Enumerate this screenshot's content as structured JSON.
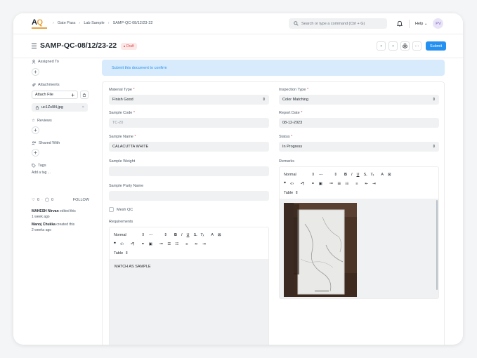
{
  "navbar": {
    "logo_text": "AQ",
    "breadcrumb": [
      "Gate Pass",
      "Lab Sample",
      "SAMP-QC-08/12/23-22"
    ],
    "search_placeholder": "Search or type a command (Ctrl + G)",
    "help_label": "Help",
    "avatar_initials": "PV"
  },
  "page": {
    "title": "SAMP-QC-08/12/23-22",
    "status": "Draft",
    "submit_label": "Submit",
    "more_label": "···"
  },
  "alert": {
    "text": "Submit this document to confirm"
  },
  "sidebar": {
    "assigned_to": "Assigned To",
    "attachments": "Attachments",
    "attach_file": "Attach File",
    "file_name": "uc1Zs9N.jpg",
    "reviews": "Reviews",
    "shared_with": "Shared With",
    "tags": "Tags",
    "add_tag": "Add a tag ...",
    "likes": "0",
    "comments": "0",
    "follow": "FOLLOW",
    "activity": [
      {
        "user": "MAHESH Nirvan",
        "action": "edited this",
        "time": "1 week ago"
      },
      {
        "user": "Manoj Chukka",
        "action": "created this",
        "time": "2 weeks ago"
      }
    ]
  },
  "form": {
    "material_type": {
      "label": "Material Type",
      "value": "Finish Good"
    },
    "sample_code": {
      "label": "Sample Code",
      "value": "TC-20"
    },
    "sample_name": {
      "label": "Sample Name",
      "value": "CALACUTTA WHITE"
    },
    "sample_weight": {
      "label": "Sample Weight",
      "value": ""
    },
    "sample_party_name": {
      "label": "Sample Party Name",
      "value": ""
    },
    "mesh_qc": {
      "label": "Mesh QC",
      "checked": false
    },
    "requirements": {
      "label": "Requirements",
      "value": "MATCH AS SAMPLE"
    },
    "inspection_type": {
      "label": "Inspection Type",
      "value": "Color Matching"
    },
    "report_date": {
      "label": "Report Date",
      "value": "08-12-2023"
    },
    "status": {
      "label": "Status",
      "value": "In Progress"
    },
    "remarks": {
      "label": "Remarks"
    }
  },
  "editor_toolbar": {
    "style": "Normal",
    "size": "---",
    "table": "Table"
  },
  "colors": {
    "accent": "#2490ef",
    "draft": "#e24c4c",
    "logo_accent": "#e8a33d"
  }
}
